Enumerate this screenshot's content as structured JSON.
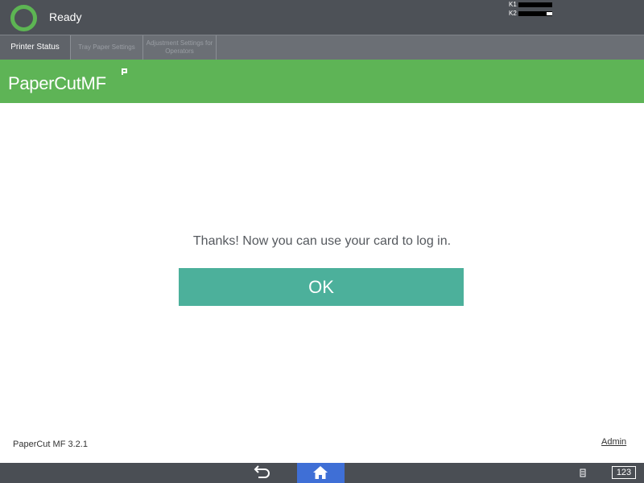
{
  "status": {
    "text": "Ready",
    "toner": [
      {
        "label": "K1",
        "level": 1.0
      },
      {
        "label": "K2",
        "level": 0.83
      }
    ]
  },
  "tabs": [
    {
      "label": "Printer Status",
      "state": "active"
    },
    {
      "label": "Tray Paper Settings",
      "state": "disabled"
    },
    {
      "label": "Adjustment Settings for Operators",
      "state": "disabled"
    }
  ],
  "brand": {
    "name": "PaperCut",
    "suffix": "MF"
  },
  "main": {
    "message": "Thanks! Now you can use your card to log in.",
    "ok_label": "OK"
  },
  "footer": {
    "version": "PaperCut MF 3.2.1",
    "admin_label": "Admin"
  },
  "bottom_bar": {
    "keyboard_label": "123"
  },
  "colors": {
    "brand_green": "#5eb456",
    "ok_button": "#4cb09b",
    "home_button": "#3f6fd6",
    "status_bar": "#4d5157"
  }
}
